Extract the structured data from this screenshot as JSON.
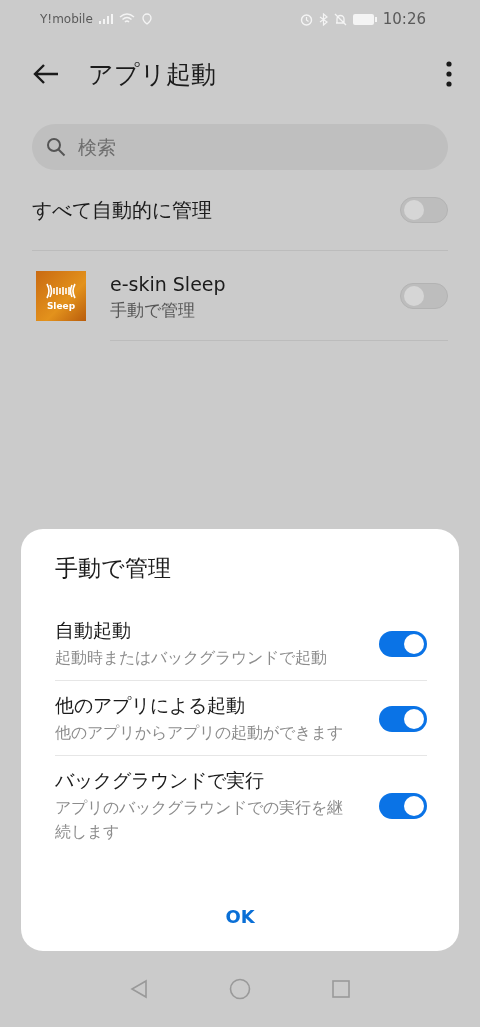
{
  "status_bar": {
    "carrier": "Y!mobile",
    "time": "10:26"
  },
  "header": {
    "title": "アプリ起動"
  },
  "search": {
    "placeholder": "検索"
  },
  "manage_all": {
    "label": "すべて自動的に管理",
    "on": false
  },
  "apps": [
    {
      "name": "e-skin Sleep",
      "status": "手動で管理",
      "icon_text": "Sleep",
      "on": false
    }
  ],
  "dialog": {
    "title": "手動で管理",
    "options": [
      {
        "label": "自動起動",
        "description": "起動時またはバックグラウンドで起動",
        "on": true
      },
      {
        "label": "他のアプリによる起動",
        "description": "他のアプリからアプリの起動ができます",
        "on": true
      },
      {
        "label": "バックグラウンドで実行",
        "description": "アプリのバックグラウンドでの実行を継続します",
        "on": true
      }
    ],
    "button": "OK"
  }
}
